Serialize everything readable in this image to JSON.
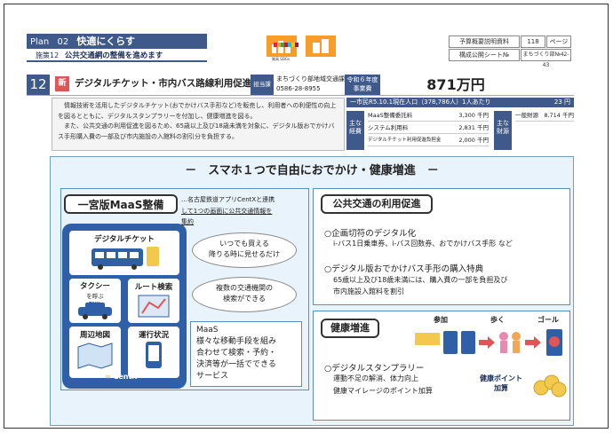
{
  "header": {
    "plan_label": "Plan",
    "plan_no": "02",
    "plan_title": "快適にくらす",
    "policy_label": "施策12",
    "policy_title": "公共交通網の整備を進めます",
    "ref1_label": "予算概要説明資料",
    "ref1_value": "118",
    "ref1_unit": "ページ",
    "ref2_label": "構成公開シート№",
    "ref2_value": "まちづくり部№42-43",
    "sdg_label1": "質高",
    "sdg_label2": "SDGs"
  },
  "project": {
    "number": "12",
    "new_badge": "新",
    "title": "デジタルチケット・市内バス路線利用促進事業",
    "resp_label": "担当課",
    "resp_dept": "まちづくり部地域交通課",
    "resp_tel": "0586-28-8955",
    "year_label_1": "令和６年度",
    "year_label_2": "事業費",
    "budget": "871万円"
  },
  "description": "　情報技術を活用したデジタルチケット(おでかけバス手形など)を販売し、利用者への利便性の向上を図るとともに、デジタルスタンプラリーを付加し、健康増進を図る。\n　また、公共交通の利用促進を図るため、65歳以上及び18歳未満を対象に、デジタル版おでかけバス手形購入費の一部及び市内施設の入館料の割引分を負担する。",
  "costs": {
    "head_label": "一市民R5.10.1現在人口（378,786人）1人あたり",
    "head_value": "23 円",
    "label_main_1": "主な",
    "label_main_2": "経費",
    "label_src_1": "主な",
    "label_src_2": "財源",
    "items": [
      {
        "name": "MaaS整備委託料",
        "value": "3,300 千円"
      },
      {
        "name": "システム利用料",
        "value": "2,831 千円"
      },
      {
        "name": "デジタルチケット利用促進負担金",
        "value": "2,000 千円"
      }
    ],
    "source_name": "一般財源",
    "source_value": "8,714 千円"
  },
  "main": {
    "title": "－　スマホ１つで自由におでかけ・健康増進　－",
    "maas_title": "一宮版MaaS整備",
    "maas_note_1": "…名古屋鉄道アプリCentXと連携",
    "maas_note_2": "して1つの画面に公共交通情報を",
    "maas_note_3": "集約",
    "tiles": {
      "digital": "デジタルチケット",
      "taxi": "タクシー",
      "taxi_sub": "を呼ぶ",
      "route": "ルート検索",
      "map": "周辺地図",
      "status": "運行状況",
      "taxi_sign": "TAXI",
      "brand": "CentX"
    },
    "bubble1_1": "いつでも買える",
    "bubble1_2": "降りる時に見せるだけ",
    "bubble2_1": "複数の交通機関の",
    "bubble2_2": "検索ができる",
    "maas_box_title": "MaaS",
    "maas_box_1": "様々な移動手段を組み",
    "maas_box_2": "合わせて検索・予約・",
    "maas_box_3": "決済等が一括でできる",
    "maas_box_4": "サービス",
    "transit_title": "公共交通の利用促進",
    "t_b1": "○企画切符のデジタル化",
    "t_b1_sub": "i-バス1日乗車券、i-バス回数券、おでかけバス手形 など",
    "t_b2": "○デジタル版おでかけバス手形の購入特典",
    "t_b2_sub1": "65歳以上及び18歳未満には、購入費の一部を負担及び",
    "t_b2_sub2": "市内施設入館料を割引",
    "health_title": "健康増進",
    "flow_1": "参加",
    "flow_2": "歩く",
    "flow_3": "ゴール",
    "h_b1": "○デジタルスタンプラリー",
    "h_b1_sub1": "運動不足の解消、体力向上",
    "h_b1_sub2": "健康マイレージのポイント加算",
    "point_1": "健康ポイント",
    "point_2": "加算"
  },
  "colors": {
    "navy": "#3f5a8a",
    "accent_red": "#e05555",
    "phone_blue": "#2f5fa6",
    "panel_bg": "#e8f3fb"
  }
}
